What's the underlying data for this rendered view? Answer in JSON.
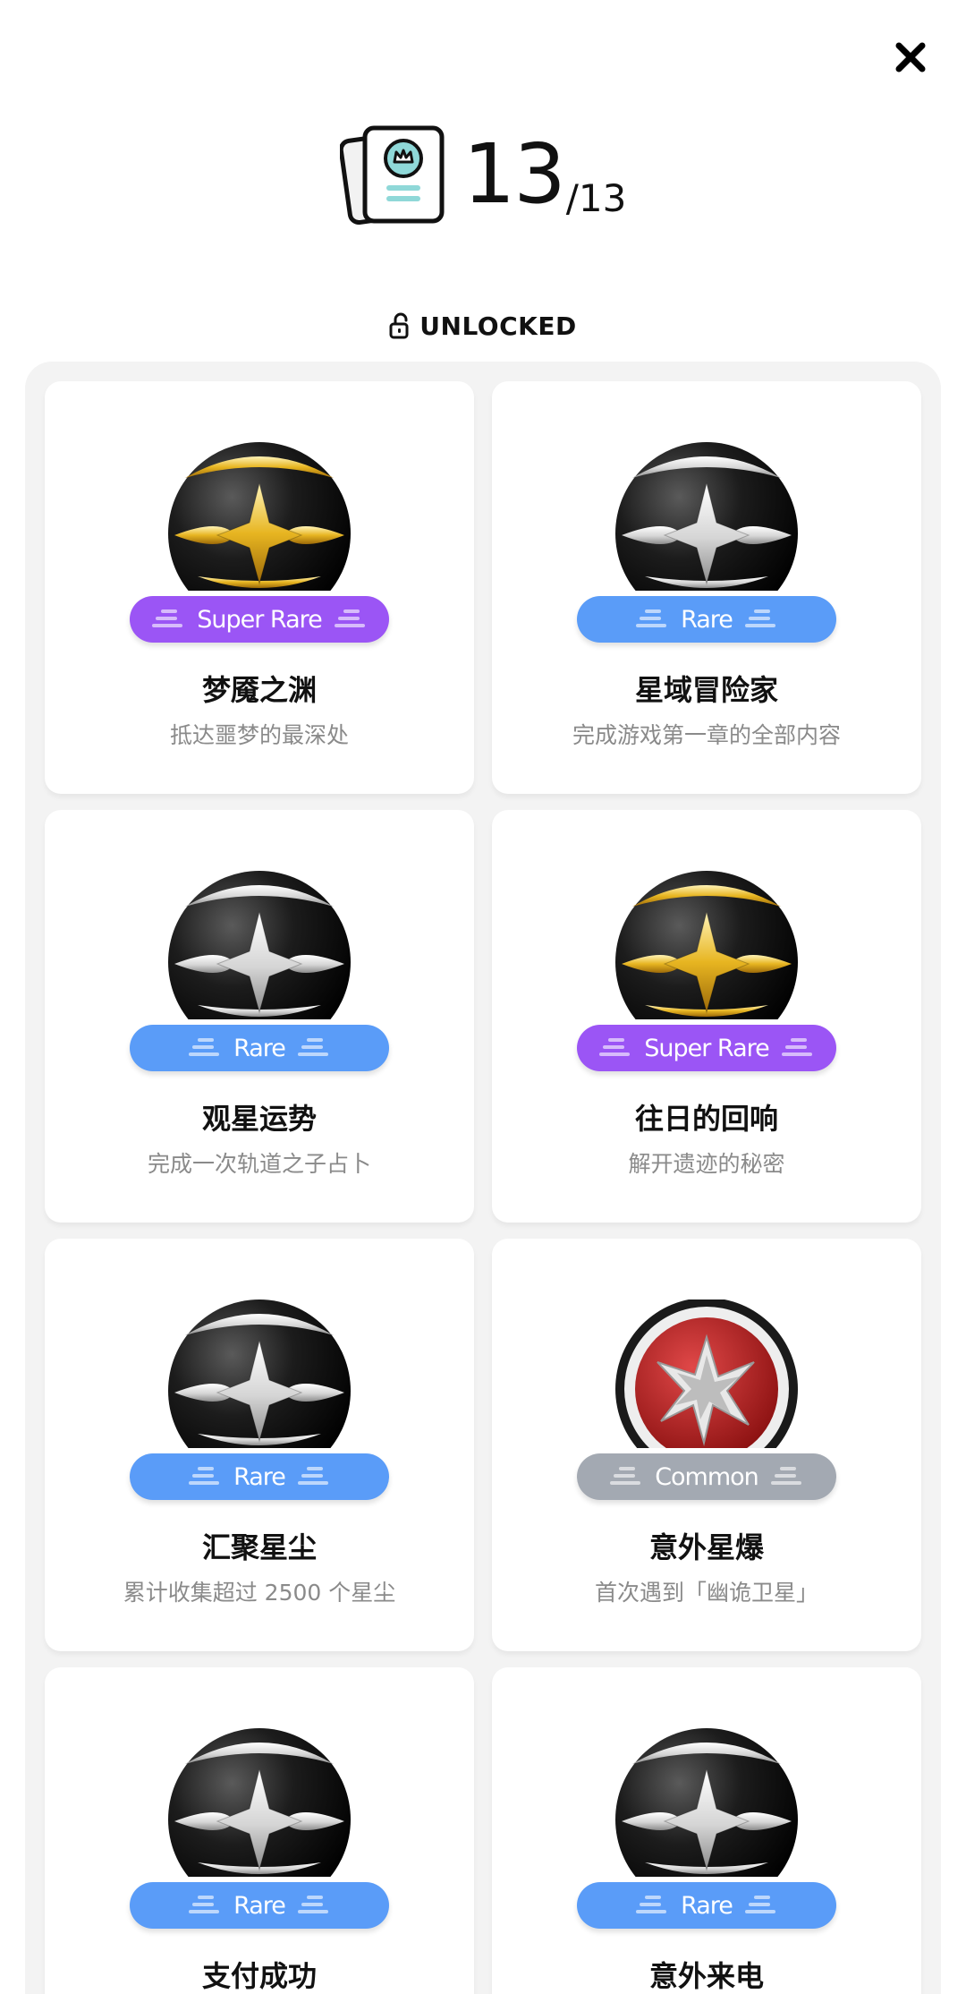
{
  "header": {
    "close_icon": "close-icon",
    "count_current": "13",
    "count_total": "/13",
    "status_label": "UNLOCKED",
    "status_icon": "unlock-icon"
  },
  "colors": {
    "super_rare": "#9b55f5",
    "rare": "#5a9cf8",
    "common": "#a3a9b2",
    "panel_bg": "#f3f3f3"
  },
  "achievements": [
    {
      "title": "梦魇之渊",
      "desc": "抵达噩梦的最深处",
      "rarity": "Super Rare",
      "tier": "super_rare",
      "medal": "gold"
    },
    {
      "title": "星域冒险家",
      "desc": "完成游戏第一章的全部内容",
      "rarity": "Rare",
      "tier": "rare",
      "medal": "silver"
    },
    {
      "title": "观星运势",
      "desc": "完成一次轨道之子占卜",
      "rarity": "Rare",
      "tier": "rare",
      "medal": "silver"
    },
    {
      "title": "往日的回响",
      "desc": "解开遗迹的秘密",
      "rarity": "Super Rare",
      "tier": "super_rare",
      "medal": "gold"
    },
    {
      "title": "汇聚星尘",
      "desc": "累计收集超过 2500 个星尘",
      "rarity": "Rare",
      "tier": "rare",
      "medal": "silver"
    },
    {
      "title": "意外星爆",
      "desc": "首次遇到「幽诡卫星」",
      "rarity": "Common",
      "tier": "common",
      "medal": "red"
    },
    {
      "title": "支付成功",
      "desc": "",
      "rarity": "Rare",
      "tier": "rare",
      "medal": "silver"
    },
    {
      "title": "意外来电",
      "desc": "",
      "rarity": "Rare",
      "tier": "rare",
      "medal": "silver"
    }
  ]
}
